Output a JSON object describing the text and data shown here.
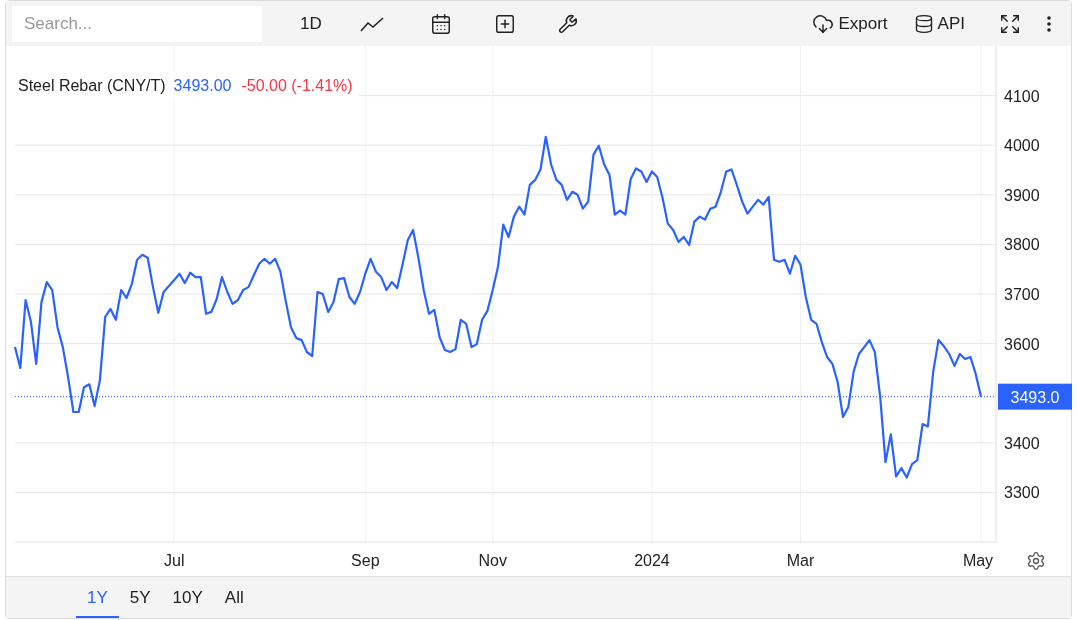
{
  "toolbar": {
    "search": {
      "placeholder": "Search..."
    },
    "interval": "1D",
    "actions": [
      {
        "kind": "export",
        "label": "Export"
      },
      {
        "kind": "api",
        "label": "API"
      }
    ]
  },
  "legend": {
    "price": "3493.00",
    "change": "-50.00 (-1.41%)"
  },
  "price_tag": "3493.0",
  "chart_data": {
    "type": "line",
    "categories": [
      null,
      null,
      null,
      null,
      null,
      null,
      null,
      null,
      null,
      null,
      null,
      null,
      null,
      null,
      null,
      null,
      null,
      null,
      null,
      null,
      null,
      null,
      null,
      null,
      null,
      null,
      null,
      null,
      null,
      null,
      "Jul",
      null,
      null,
      null,
      null,
      null,
      null,
      null,
      null,
      null,
      null,
      null,
      null,
      null,
      null,
      null,
      null,
      null,
      null,
      null,
      null,
      null,
      null,
      null,
      null,
      null,
      null,
      null,
      null,
      null,
      null,
      null,
      null,
      null,
      null,
      null,
      "Sep",
      null,
      null,
      null,
      null,
      null,
      null,
      null,
      null,
      null,
      null,
      null,
      null,
      null,
      null,
      null,
      null,
      null,
      null,
      null,
      null,
      null,
      null,
      null,
      "Nov",
      null,
      null,
      null,
      null,
      null,
      null,
      null,
      null,
      null,
      null,
      null,
      null,
      null,
      null,
      null,
      null,
      null,
      null,
      null,
      null,
      null,
      null,
      null,
      null,
      null,
      null,
      null,
      null,
      null,
      "2024",
      null,
      null,
      null,
      null,
      null,
      null,
      null,
      null,
      null,
      null,
      null,
      null,
      null,
      null,
      null,
      null,
      null,
      null,
      null,
      null,
      null,
      null,
      null,
      null,
      null,
      null,
      null,
      "Mar",
      null,
      null,
      null,
      null,
      null,
      null,
      null,
      null,
      null,
      null,
      null,
      null,
      null,
      null,
      null,
      null,
      null,
      null,
      null,
      null,
      null,
      null,
      null,
      null,
      null,
      null,
      null,
      null,
      null,
      null,
      null,
      null,
      null,
      "May"
    ],
    "series": [
      {
        "name": "Steel Rebar (CNY/T)",
        "color": "#2962ff",
        "values": [
          3593,
          3551,
          3688,
          3644,
          3559,
          3684,
          3724,
          3708,
          3633,
          3593,
          3532,
          3462,
          3462,
          3512,
          3518,
          3474,
          3526,
          3654,
          3670,
          3648,
          3708,
          3692,
          3720,
          3769,
          3779,
          3773,
          3714,
          3662,
          3704,
          3716,
          3728,
          3741,
          3722,
          3743,
          3734,
          3734,
          3660,
          3664,
          3690,
          3734,
          3704,
          3680,
          3688,
          3708,
          3714,
          3738,
          3761,
          3771,
          3761,
          3771,
          3745,
          3686,
          3633,
          3611,
          3607,
          3583,
          3575,
          3704,
          3700,
          3664,
          3684,
          3730,
          3732,
          3694,
          3680,
          3704,
          3741,
          3771,
          3745,
          3734,
          3708,
          3724,
          3712,
          3759,
          3809,
          3829,
          3773,
          3708,
          3660,
          3668,
          3613,
          3587,
          3583,
          3589,
          3648,
          3640,
          3593,
          3599,
          3648,
          3666,
          3708,
          3755,
          3840,
          3815,
          3856,
          3876,
          3860,
          3920,
          3930,
          3951,
          4017,
          3961,
          3930,
          3920,
          3890,
          3906,
          3900,
          3872,
          3886,
          3981,
          3999,
          3961,
          3940,
          3860,
          3868,
          3860,
          3932,
          3953,
          3947,
          3926,
          3947,
          3936,
          3894,
          3842,
          3829,
          3805,
          3815,
          3799,
          3846,
          3856,
          3850,
          3872,
          3876,
          3906,
          3947,
          3951,
          3920,
          3886,
          3862,
          3876,
          3890,
          3880,
          3896,
          3769,
          3765,
          3769,
          3741,
          3777,
          3759,
          3694,
          3648,
          3640,
          3603,
          3573,
          3559,
          3522,
          3452,
          3472,
          3543,
          3579,
          3593,
          3607,
          3583,
          3492,
          3361,
          3417,
          3332,
          3349,
          3330,
          3357,
          3365,
          3438,
          3433,
          3543,
          3607,
          3595,
          3579,
          3555,
          3579,
          3569,
          3573,
          3539,
          3493
        ]
      }
    ],
    "ylim": [
      3200,
      4200
    ],
    "grid": true,
    "ref_lines": [
      {
        "axis": "y",
        "value": 3493
      }
    ],
    "yticks": [
      3300,
      3400,
      3600,
      3700,
      3800,
      3900,
      4000,
      4100
    ]
  },
  "ranges": [
    {
      "label": "1Y",
      "selected": true
    },
    {
      "label": "5Y",
      "selected": false
    },
    {
      "label": "10Y",
      "selected": false
    },
    {
      "label": "All",
      "selected": false
    }
  ]
}
